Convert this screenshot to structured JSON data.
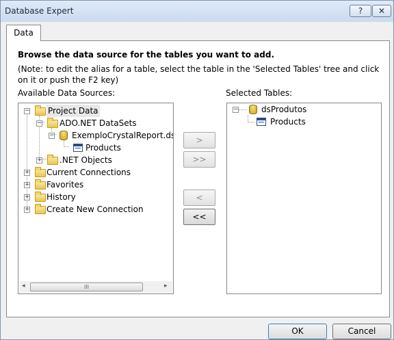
{
  "window": {
    "title": "Database Expert",
    "help_label": "?",
    "close_label": "✕"
  },
  "tabs": [
    {
      "label": "Data"
    }
  ],
  "main": {
    "heading": "Browse the data source for the tables you want to add.",
    "note": "(Note: to edit the alias for a table, select the table in the 'Selected Tables' tree and click on it or push the F2 key)",
    "available_label": "Available Data Sources:",
    "selected_label": "Selected Tables:"
  },
  "available_tree": {
    "project_data": "Project Data",
    "ado_net_datasets": "ADO.NET DataSets",
    "dataset": "ExemploCrystalReport.dsPro",
    "products": "Products",
    "net_objects": ".NET Objects",
    "current_connections": "Current Connections",
    "favorites": "Favorites",
    "history": "History",
    "create_new_connection": "Create New Connection"
  },
  "selected_tree": {
    "dataset": "dsProdutos",
    "products": "Products"
  },
  "move_buttons": {
    "add": ">",
    "add_all": ">>",
    "remove": "<",
    "remove_all": "<<"
  },
  "scrollbar": {
    "left_arrow": "◂",
    "right_arrow": "▸",
    "grip": "III"
  },
  "dialog_buttons": {
    "ok": "OK",
    "cancel": "Cancel"
  }
}
